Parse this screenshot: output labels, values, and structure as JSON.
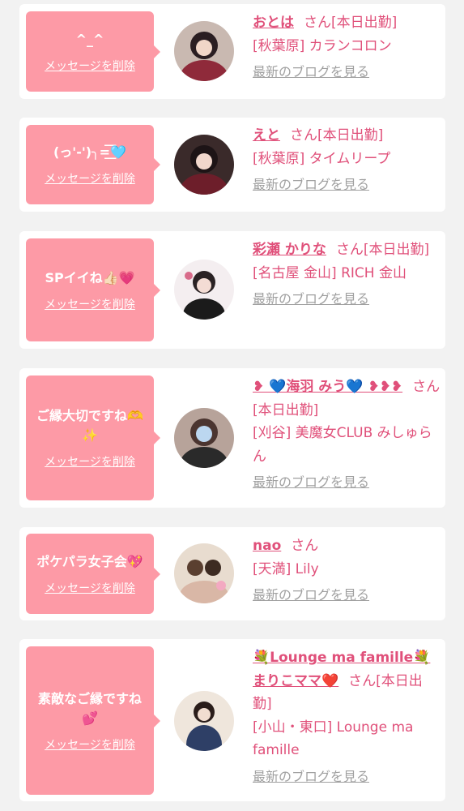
{
  "delete_label": "メッセージを削除",
  "blog_label": "最新のブログを見る",
  "colors": {
    "accent": "#e0507a",
    "bubble": "#fd9aa6",
    "muted": "#a0a0a0"
  },
  "cards": [
    {
      "message": "^_^",
      "name": "おとは",
      "status": "さん[本日出勤]",
      "shop": "[秋葉原] カランコロン"
    },
    {
      "message": "(っ'-')╮=͟͟͞͞🩵",
      "name": "えと",
      "status": "さん[本日出勤]",
      "shop": "[秋葉原] タイムリープ"
    },
    {
      "message": "SPイイね👍🏻💗",
      "name": "彩瀬 かりな",
      "status": "さん[本日出勤]",
      "shop": "[名古屋 金山] RICH 金山"
    },
    {
      "message": "ご縁大切ですね🫶✨",
      "name": "❥ 💙海羽 みう💙 ❥❥❥",
      "status": "さん[本日出勤]",
      "shop": "[刈谷] 美魔女CLUB みしゅらん"
    },
    {
      "message": "ポケパラ女子会💖",
      "name": "nao",
      "status": "さん",
      "shop": "[天満] Lily"
    },
    {
      "message": "素敵なご縁ですね💕",
      "name": "💐Lounge ma famille💐 まりこママ❤️",
      "status": "さん[本日出勤]",
      "shop": "[小山・東口] Lounge ma famille"
    }
  ]
}
